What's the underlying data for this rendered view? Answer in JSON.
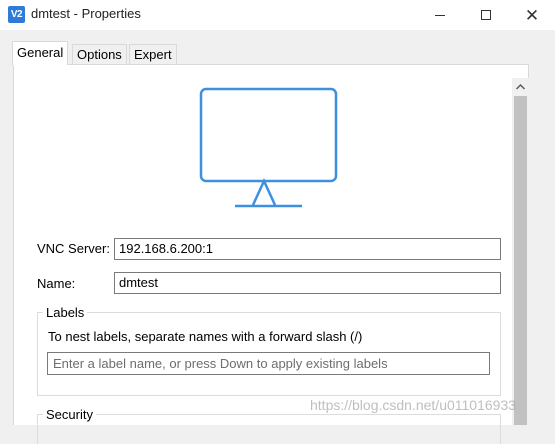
{
  "window": {
    "app_icon_text": "V2",
    "title": "dmtest - Properties",
    "controls": {
      "minimize": "minimize-icon",
      "maximize": "maximize-icon",
      "close": "close-icon"
    }
  },
  "tabs": [
    {
      "label": "General",
      "active": true
    },
    {
      "label": "Options",
      "active": false
    },
    {
      "label": "Expert",
      "active": false
    }
  ],
  "general": {
    "vnc_server_label": "VNC Server:",
    "vnc_server_value": "192.168.6.200:1",
    "name_label": "Name:",
    "name_value": "dmtest",
    "labels_group": {
      "caption": "Labels",
      "hint": "To nest labels, separate names with a forward slash (/)",
      "input_placeholder": "Enter a label name, or press Down to apply existing labels"
    },
    "security_group": {
      "caption": "Security"
    }
  },
  "watermark": "https://blog.csdn.net/u011016933",
  "colors": {
    "accent": "#3d8fe0",
    "window_bg": "#f0f0f0",
    "panel_bg": "#ffffff"
  }
}
